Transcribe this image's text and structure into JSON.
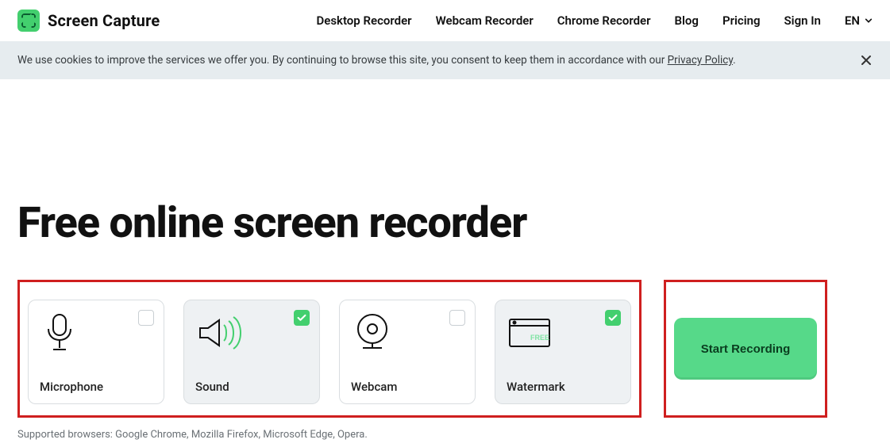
{
  "brand": {
    "name": "Screen Capture"
  },
  "nav": {
    "links": [
      "Desktop Recorder",
      "Webcam Recorder",
      "Chrome Recorder",
      "Blog",
      "Pricing",
      "Sign In"
    ],
    "lang": "EN"
  },
  "cookie": {
    "text_pre": "We use cookies to improve the services we offer you. By continuing to browse this site, you consent to keep them in accordance with our ",
    "link": "Privacy Policy",
    "text_post": "."
  },
  "hero": {
    "title": "Free online screen recorder"
  },
  "options": [
    {
      "id": "microphone",
      "label": "Microphone",
      "checked": false
    },
    {
      "id": "sound",
      "label": "Sound",
      "checked": true
    },
    {
      "id": "webcam",
      "label": "Webcam",
      "checked": false
    },
    {
      "id": "watermark",
      "label": "Watermark",
      "checked": true
    }
  ],
  "cta": {
    "label": "Start Recording"
  },
  "support": {
    "text": "Supported browsers: Google Chrome, Mozilla Firefox, Microsoft Edge, Opera."
  }
}
